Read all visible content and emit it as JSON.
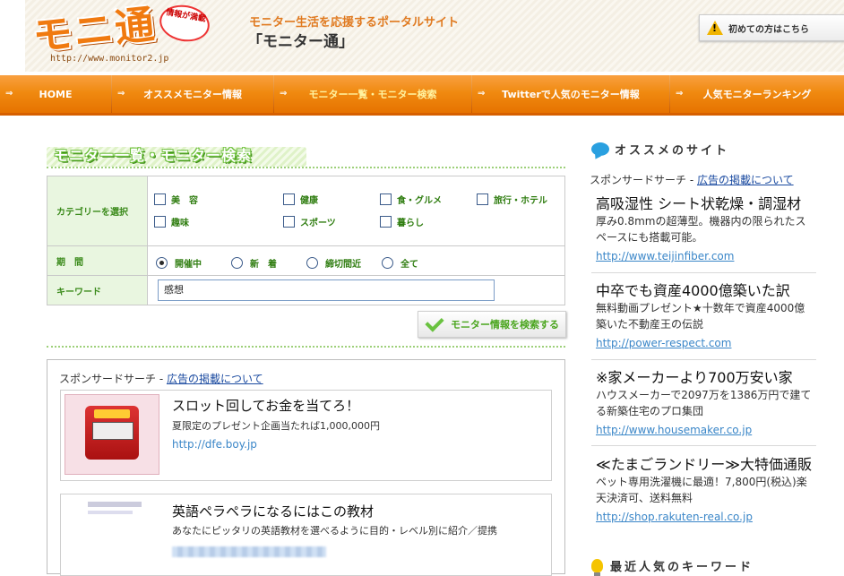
{
  "header": {
    "logo_text": "モニ通",
    "logo_badge": "情報が満載",
    "logo_url": "http://www.monitor2.jp",
    "tagline": "モニター生活を応援するポータルサイト",
    "site_name": "「モニター通」",
    "first_time_label": "初めての方はこちら"
  },
  "nav": {
    "items": [
      {
        "label": "HOME"
      },
      {
        "label": "オススメモニター情報"
      },
      {
        "label": "モニター一覧・モニター検索"
      },
      {
        "label": "Twitterで人気のモニター情報"
      },
      {
        "label": "人気モニターランキング"
      }
    ],
    "active_index": 2
  },
  "search": {
    "section_title": "モニター一覧・モニター検索",
    "category_label": "カテゴリーを選択",
    "categories": [
      "美　容",
      "健康",
      "食・グルメ",
      "旅行・ホテル",
      "趣味",
      "スポーツ",
      "暮らし"
    ],
    "period_label": "期　間",
    "periods": [
      "開催中",
      "新　着",
      "締切間近",
      "全て"
    ],
    "selected_period": "開催中",
    "keyword_label": "キーワード",
    "keyword_value": "感想",
    "search_button": "モニター情報を検索する"
  },
  "main_ads": {
    "sponsor_prefix": "スポンサードサーチ - ",
    "sponsor_link": "広告の掲載について",
    "items": [
      {
        "title": "スロット回してお金を当てろ！",
        "desc": "夏限定のプレゼント企画当たれば1,000,000円",
        "url": "http://dfe.boy.jp"
      },
      {
        "title": "英語ペラペラになるにはこの教材",
        "desc": "あなたにピッタリの英語教材を選べるように目的・レベル別に紹介／提携",
        "url": ""
      }
    ]
  },
  "sidebar": {
    "recommend_heading": "オススメのサイト",
    "sponsor_prefix": "スポンサードサーチ - ",
    "sponsor_link": "広告の掲載について",
    "ads": [
      {
        "title": "高吸湿性 シート状乾燥・調湿材",
        "desc": "厚み0.8mmの超薄型。機器内の限られたスペースにも搭載可能。",
        "url": "http://www.teijinfiber.com"
      },
      {
        "title": "中卒でも資産4000億築いた訳",
        "desc": "無料動画プレゼント★十数年で資産4000億築いた不動産王の伝説",
        "url": "http://power-respect.com"
      },
      {
        "title": "※家メーカーより700万安い家",
        "desc": "ハウスメーカーで2097万を1386万円で建てる新築住宅のプロ集団",
        "url": "http://www.housemaker.co.jp"
      },
      {
        "title": "≪たまごランドリー≫大特価通販",
        "desc": "ペット専用洗濯機に最適！7,800円(税込)楽天決済可、送料無料",
        "url": "http://shop.rakuten-real.co.jp"
      }
    ],
    "keyword_heading": "最近人気のキーワード"
  }
}
